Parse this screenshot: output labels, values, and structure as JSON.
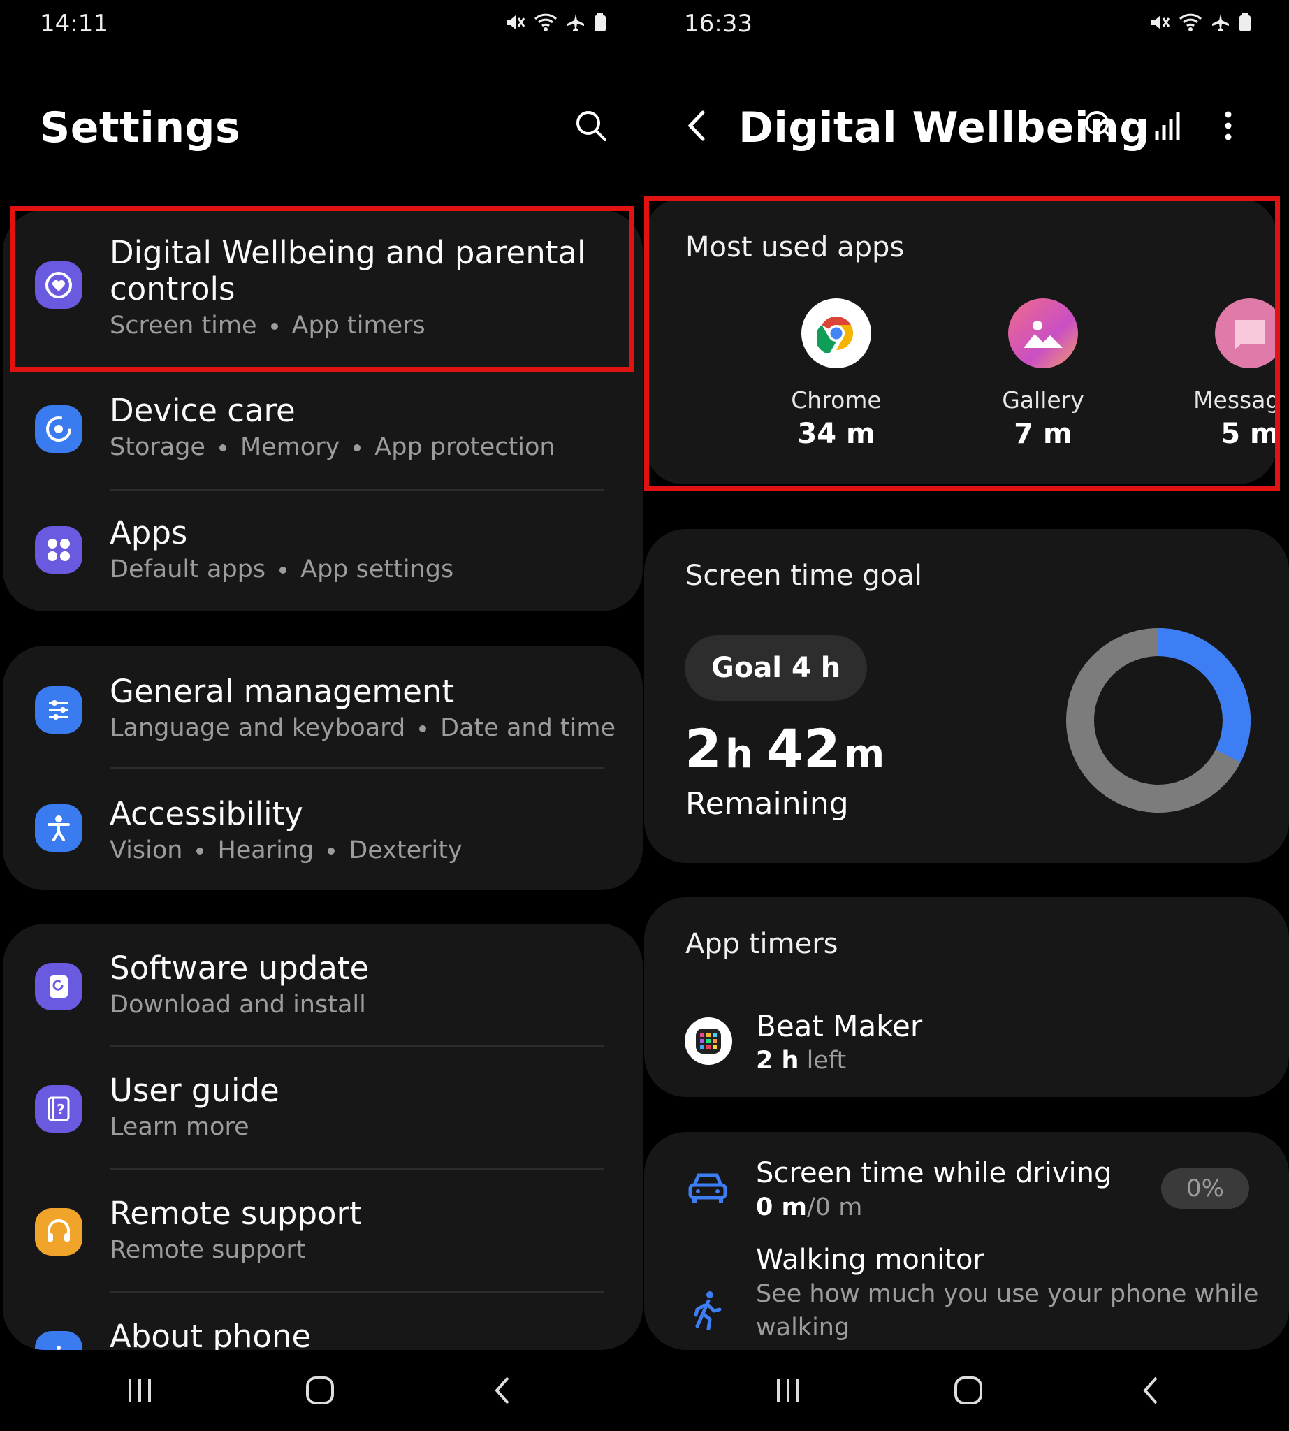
{
  "left": {
    "status_time": "14:11",
    "header_title": "Settings",
    "items": [
      {
        "title": "Digital Wellbeing and parental controls",
        "title_line1": "Digital Wellbeing and parental",
        "title_line2": "controls",
        "subs": [
          "Screen time",
          "App timers"
        ],
        "icon": "wellbeing-icon",
        "color": "#6a5ae0"
      },
      {
        "title": "Device care",
        "subs": [
          "Storage",
          "Memory",
          "App protection"
        ],
        "icon": "device-care-icon",
        "color": "#3b7bf0"
      },
      {
        "title": "Apps",
        "subs": [
          "Default apps",
          "App settings"
        ],
        "icon": "apps-icon",
        "color": "#6a5ae0"
      },
      {
        "title": "General management",
        "subs": [
          "Language and keyboard",
          "Date and time"
        ],
        "icon": "sliders-icon",
        "color": "#3b7bf0"
      },
      {
        "title": "Accessibility",
        "subs": [
          "Vision",
          "Hearing",
          "Dexterity"
        ],
        "icon": "accessibility-icon",
        "color": "#3b7bf0"
      },
      {
        "title": "Software update",
        "subs": [
          "Download and install"
        ],
        "icon": "software-update-icon",
        "color": "#6a5ae0"
      },
      {
        "title": "User guide",
        "subs": [
          "Learn more"
        ],
        "icon": "user-guide-icon",
        "color": "#6a5ae0"
      },
      {
        "title": "Remote support",
        "subs": [
          "Remote support"
        ],
        "icon": "headset-icon",
        "color": "#f0a52a"
      },
      {
        "title": "About phone",
        "subs": [],
        "icon": "info-icon",
        "color": "#3b7bf0"
      }
    ]
  },
  "right": {
    "status_time": "16:33",
    "header_title": "Digital Wellbeing",
    "most_used": {
      "title": "Most used apps",
      "apps": [
        {
          "name": "Chrome",
          "time": "34 m",
          "icon": "chrome-icon"
        },
        {
          "name": "Gallery",
          "time": "7 m",
          "icon": "gallery-icon"
        },
        {
          "name": "Messages",
          "time": "5 m",
          "icon": "messages-icon"
        }
      ]
    },
    "goal": {
      "title": "Screen time goal",
      "chip": "Goal 4 h",
      "remaining_h": "2",
      "remaining_h_unit": "h",
      "remaining_m": "42",
      "remaining_m_unit": "m",
      "remaining_label": "Remaining",
      "used_fraction": 0.325,
      "ring_used_color": "#3d7ef5",
      "ring_rest_color": "#7c7c7c"
    },
    "timers": {
      "title": "App timers",
      "app_name": "Beat Maker",
      "left_value": "2 h",
      "left_suffix": " left",
      "icon": "beat-maker-icon"
    },
    "driving": {
      "title": "Screen time while driving",
      "value_bold": "0 m",
      "value_rest": "/0 m",
      "badge": "0%",
      "icon": "car-icon"
    },
    "walking": {
      "title": "Walking monitor",
      "sub": "See how much you use your phone while",
      "sub2": "walking",
      "icon": "walking-icon"
    }
  },
  "colors": {
    "highlight": "#e01212",
    "accent": "#3d7ef5"
  }
}
